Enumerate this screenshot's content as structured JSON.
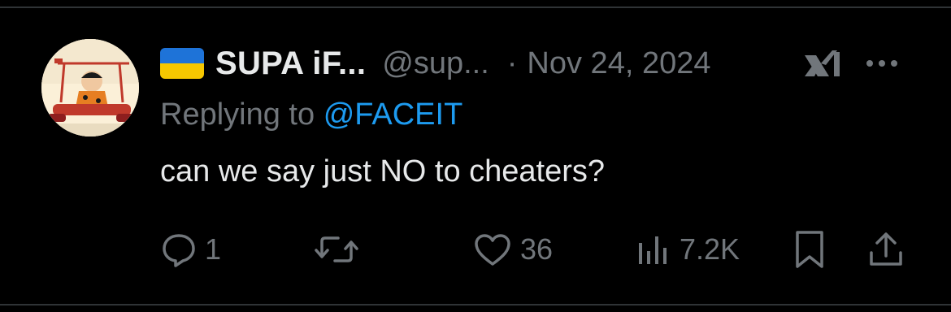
{
  "author": {
    "display_name": "SUPA iF...",
    "handle": "@sup...",
    "separator": "·",
    "date": "Nov 24, 2024",
    "flag_colors": {
      "top": "#1e73d8",
      "bottom": "#f6c700"
    }
  },
  "reply": {
    "prefix": "Replying to",
    "mention": "@FACEIT"
  },
  "tweet": {
    "text": "can we say just NO to cheaters?"
  },
  "actions": {
    "replies": "1",
    "retweets": "",
    "likes": "36",
    "views": "7.2K"
  },
  "icons": [
    "grok-icon",
    "more-icon",
    "reply-icon",
    "retweet-icon",
    "like-icon",
    "views-icon",
    "bookmark-icon",
    "share-icon"
  ],
  "colors": {
    "background": "#000000",
    "text": "#e7e9ea",
    "muted": "#71767b",
    "link": "#1d9bf0",
    "divider": "#2f3336"
  }
}
